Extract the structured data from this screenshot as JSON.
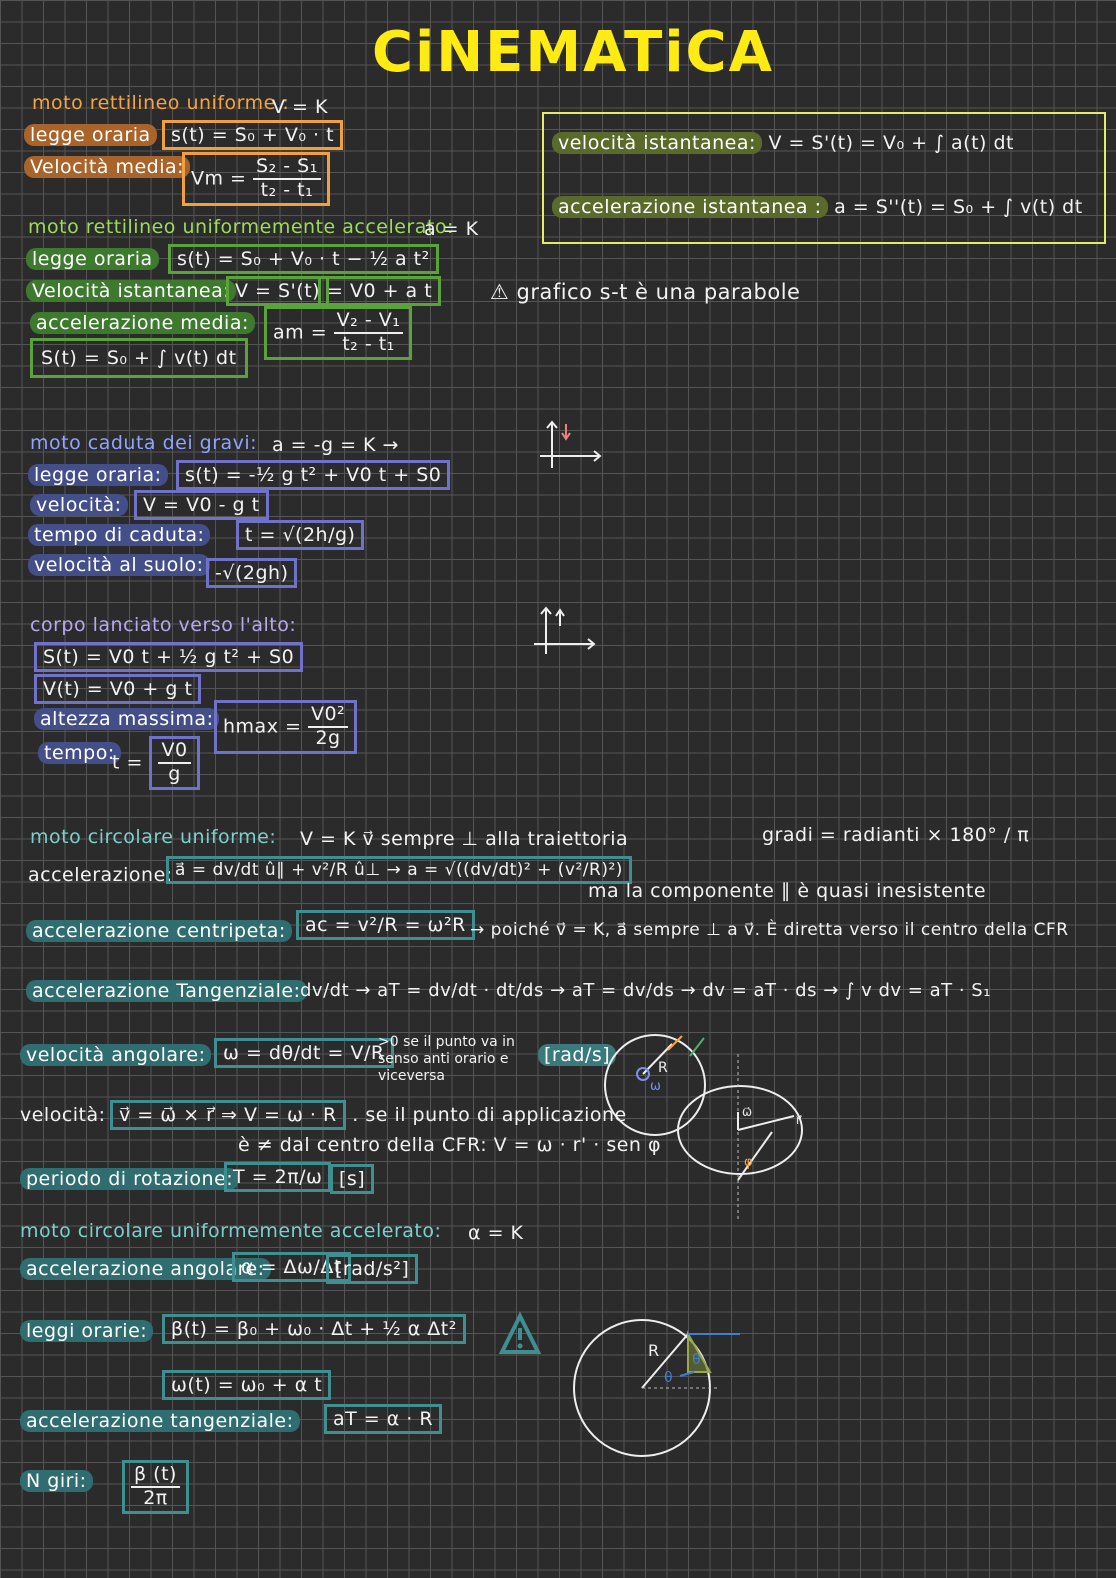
{
  "title": "CiNEMATiCA",
  "sec1": {
    "heading": "moto rettilineo uniforme :",
    "cond": "V = K",
    "legge_label": "legge oraria",
    "legge_formula": "s(t) = S₀ + V₀ · t",
    "vm_label": "Velocità media:",
    "vm_lhs": "Vm =",
    "vm_num": "S₂ - S₁",
    "vm_den": "t₂ - t₁"
  },
  "box_right": {
    "v_label": "velocità istantanea:",
    "v_formula": "V = S'(t) = V₀ + ∫ a(t) dt",
    "a_label": "accelerazione istantanea :",
    "a_formula": "a = S''(t) = S₀ + ∫ v(t) dt"
  },
  "sec2": {
    "heading": "moto rettilineo uniformemente accelerato:",
    "cond": "a = K",
    "legge_label": "legge oraria",
    "legge_formula": "s(t) = S₀ + V₀ · t − ½ a t²",
    "v_label": "Velocità istantanea:",
    "v_formula1": "V = S'(t)",
    "v_formula2": "= V0 + a t",
    "am_label": "accelerazione media:",
    "am_lhs": "am =",
    "am_num": "V₂ - V₁",
    "am_den": "t₂ - t₁",
    "s_formula": "S(t) = S₀ + ∫ v(t) dt",
    "note": "⚠ grafico s-t è una parabole"
  },
  "sec3": {
    "heading": "moto caduta dei gravi:",
    "cond": "a = -g = K  →",
    "legge_label": "legge oraria:",
    "legge_formula": "s(t) = -½ g t² + V0 t + S0",
    "v_label": "velocità:",
    "v_formula": "V = V0 - g t",
    "t_label": "tempo di caduta:",
    "t_formula": "t = √(2h/g)",
    "vs_label": "velocità al suolo:",
    "vs_formula": "-√(2gh)"
  },
  "sec4": {
    "heading": "corpo lanciato verso l'alto:",
    "s_formula": "S(t) = V0 t + ½ g t² + S0",
    "v_formula": "V(t) = V0 + g t",
    "h_label": "altezza massima:",
    "h_lhs": "hmax =",
    "h_num": "V0²",
    "h_den": "2g",
    "t_label": "tempo:",
    "t_lhs": "t =",
    "t_num": "V0",
    "t_den": "g"
  },
  "sec5": {
    "heading": "moto circolare uniforme:",
    "cond": "V = K  v⃗ sempre ⊥ alla traiettoria",
    "gradi": "gradi = radianti × 180° / π",
    "acc_label": "accelerazione:",
    "acc_formula": "a⃗ = dv/dt û∥ + v²/R û⊥ → a = √((dv/dt)² + (v²/R)²)",
    "acc_note": "ma la componente ∥ è quasi inesistente",
    "ac_label": "accelerazione centripeta:",
    "ac_formula": "ac = v²/R = ω²R",
    "ac_note": "→ poiché v⃗ = K, a⃗ sempre ⊥ a v⃗. È diretta verso il centro della CFR",
    "at_label": "accelerazione Tangenziale:",
    "at_formula": "dv/dt → aT = dv/dt · dt/ds → aT = dv/ds → dv = aT · ds → ∫ v dv = aT · S₁",
    "w_label": "velocità angolare:",
    "w_formula": "ω = dθ/dt = V/R",
    "w_note": ">0 se il punto va in senso anti orario e viceversa",
    "w_unit": "[rad/s]",
    "vel_label": "velocità:",
    "vel_formula": "v⃗ = ω⃗ × r⃗ ⇒ V = ω · R",
    "vel_note": ". se il punto di applicazione",
    "vel_note2": "è ≠ dal centro della CFR:  V = ω · r' · sen φ",
    "T_label": "periodo di rotazione:",
    "T_formula": "T = 2π/ω",
    "T_unit": "[s]"
  },
  "sec6": {
    "heading": "moto circolare uniformemente accelerato:",
    "cond": "α = K",
    "aa_label": "accelerazione angolare:",
    "aa_formula": "α = Δω/Δt",
    "aa_unit": "[rad/s²]",
    "leggi_label": "leggi orarie:",
    "leggi_formula": "β(t) = β₀ + ω₀ · Δt + ½ α Δt²",
    "w_formula": "ω(t) = ω₀ + α t",
    "at_label": "accelerazione tangenziale:",
    "at_formula": "aT = α · R",
    "giri_label": "N giri:",
    "giri_num": "β (t)",
    "giri_den": "2π"
  },
  "colors": {
    "title": "#ffeb14",
    "orange": "#f5a441",
    "green": "#9bdc5a",
    "blue": "#8fa3ff",
    "teal": "#7ad0cf"
  }
}
